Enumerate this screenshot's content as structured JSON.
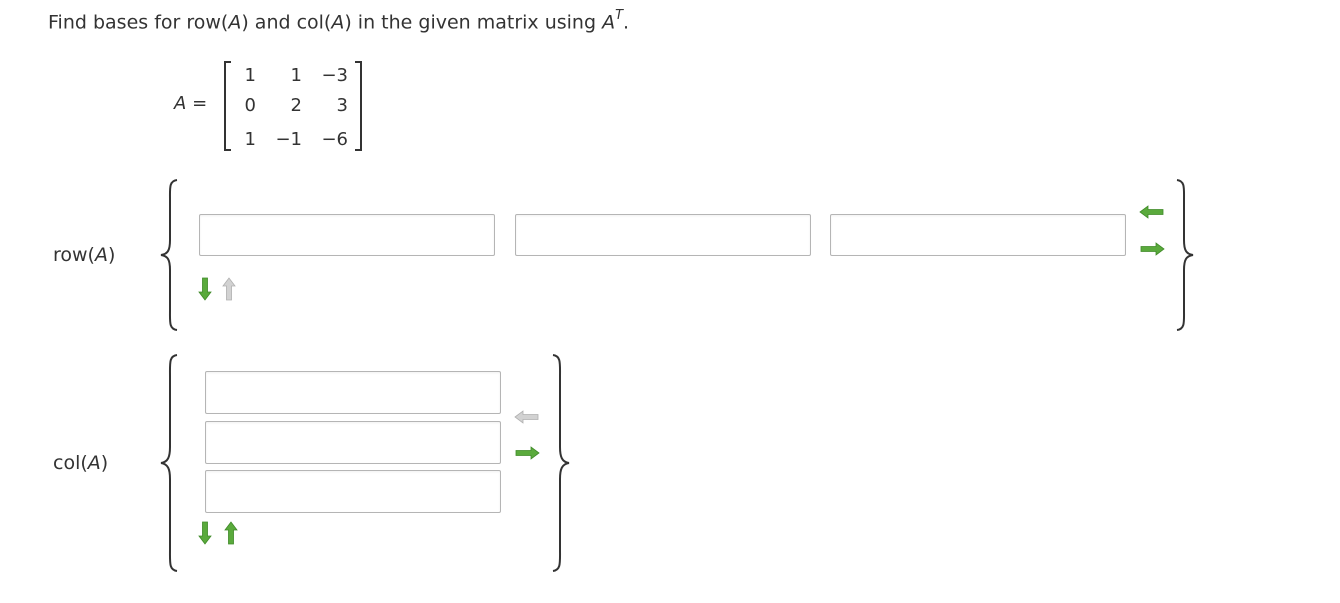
{
  "question": {
    "prefix": "Find bases for row(",
    "var1": "A",
    "mid1": ") and col(",
    "var2": "A",
    "suffix": ") in the given matrix using ",
    "var3": "A",
    "sup": "T",
    "end": "."
  },
  "matrix": {
    "name": "A",
    "equals": "=",
    "rows": [
      [
        "1",
        "1",
        "−3"
      ],
      [
        "0",
        "2",
        "3"
      ],
      [
        "1",
        "−1",
        "−6"
      ]
    ]
  },
  "row_space": {
    "label_prefix": "row(",
    "label_var": "A",
    "label_suffix": ")",
    "inputs": [
      "",
      "",
      ""
    ]
  },
  "col_space": {
    "label_prefix": "col(",
    "label_var": "A",
    "label_suffix": ")",
    "inputs": [
      "",
      "",
      ""
    ]
  },
  "colors": {
    "arrow_active": "#5aaa3c",
    "arrow_disabled": "#c8c8c8"
  },
  "icons": {
    "row_left_arrow": "arrow-left-icon",
    "row_right_arrow": "arrow-right-icon",
    "row_down_arrow": "arrow-down-icon",
    "row_up_arrow": "arrow-up-icon",
    "col_left_arrow": "arrow-left-icon",
    "col_right_arrow": "arrow-right-icon",
    "col_down_arrow": "arrow-down-icon",
    "col_up_arrow": "arrow-up-icon"
  }
}
